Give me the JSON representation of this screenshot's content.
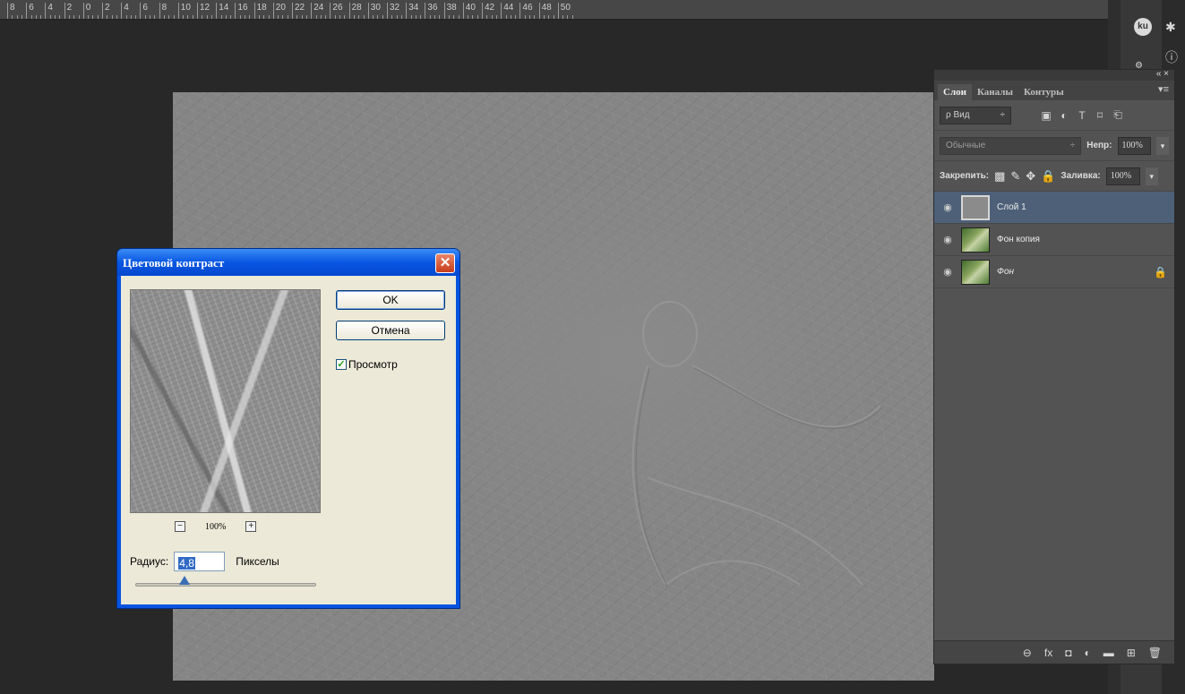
{
  "ruler": {
    "labels": [
      "8",
      "6",
      "4",
      "2",
      "0",
      "2",
      "4",
      "6",
      "8",
      "10",
      "12",
      "14",
      "16",
      "18",
      "20",
      "22",
      "24",
      "26",
      "28",
      "30",
      "32",
      "34",
      "36",
      "38",
      "40",
      "42",
      "44",
      "46",
      "48",
      "50"
    ]
  },
  "right_strip": {
    "avatar": "ku",
    "icons": [
      "asterisk-icon",
      "info-icon",
      "gear-icon",
      "paragraph-icon"
    ]
  },
  "layers_panel": {
    "collapse_label": "« ×",
    "tabs": [
      "Слои",
      "Каналы",
      "Контуры"
    ],
    "active_tab": "Слои",
    "filter": {
      "label": "ρ Вид",
      "arrow": "÷"
    },
    "filter_icons": [
      "▣",
      "◐",
      "T",
      "⌑",
      "⎗"
    ],
    "blend_mode": {
      "value": "Обычные",
      "arrow": "÷"
    },
    "opacity": {
      "label": "Непр:",
      "value": "100%"
    },
    "lock": {
      "label": "Закрепить:",
      "icons": [
        "▩",
        "✎",
        "✥",
        "🔒"
      ]
    },
    "fill": {
      "label": "Заливка:",
      "value": "100%"
    },
    "layers": [
      {
        "name": "Слой 1",
        "selected": true,
        "italic": false,
        "locked": false
      },
      {
        "name": "Фон копия",
        "selected": false,
        "italic": false,
        "locked": false
      },
      {
        "name": "Фон",
        "selected": false,
        "italic": true,
        "locked": true
      }
    ],
    "footer_icons": [
      "⊖",
      "fx",
      "◘",
      "◐",
      "▬",
      "⊞",
      "🗑"
    ]
  },
  "dialog": {
    "title": "Цветовой контраст",
    "close_glyph": "✕",
    "ok_label": "OK",
    "cancel_label": "Отмена",
    "preview_checkbox_label": "Просмотр",
    "preview_checked": true,
    "zoom_value": "100%",
    "zoom_out_glyph": "−",
    "zoom_in_glyph": "+",
    "radius_label": "Радиус:",
    "radius_value": "4,8",
    "radius_unit": "Пикселы",
    "radius_slider_fraction": 0.27
  }
}
